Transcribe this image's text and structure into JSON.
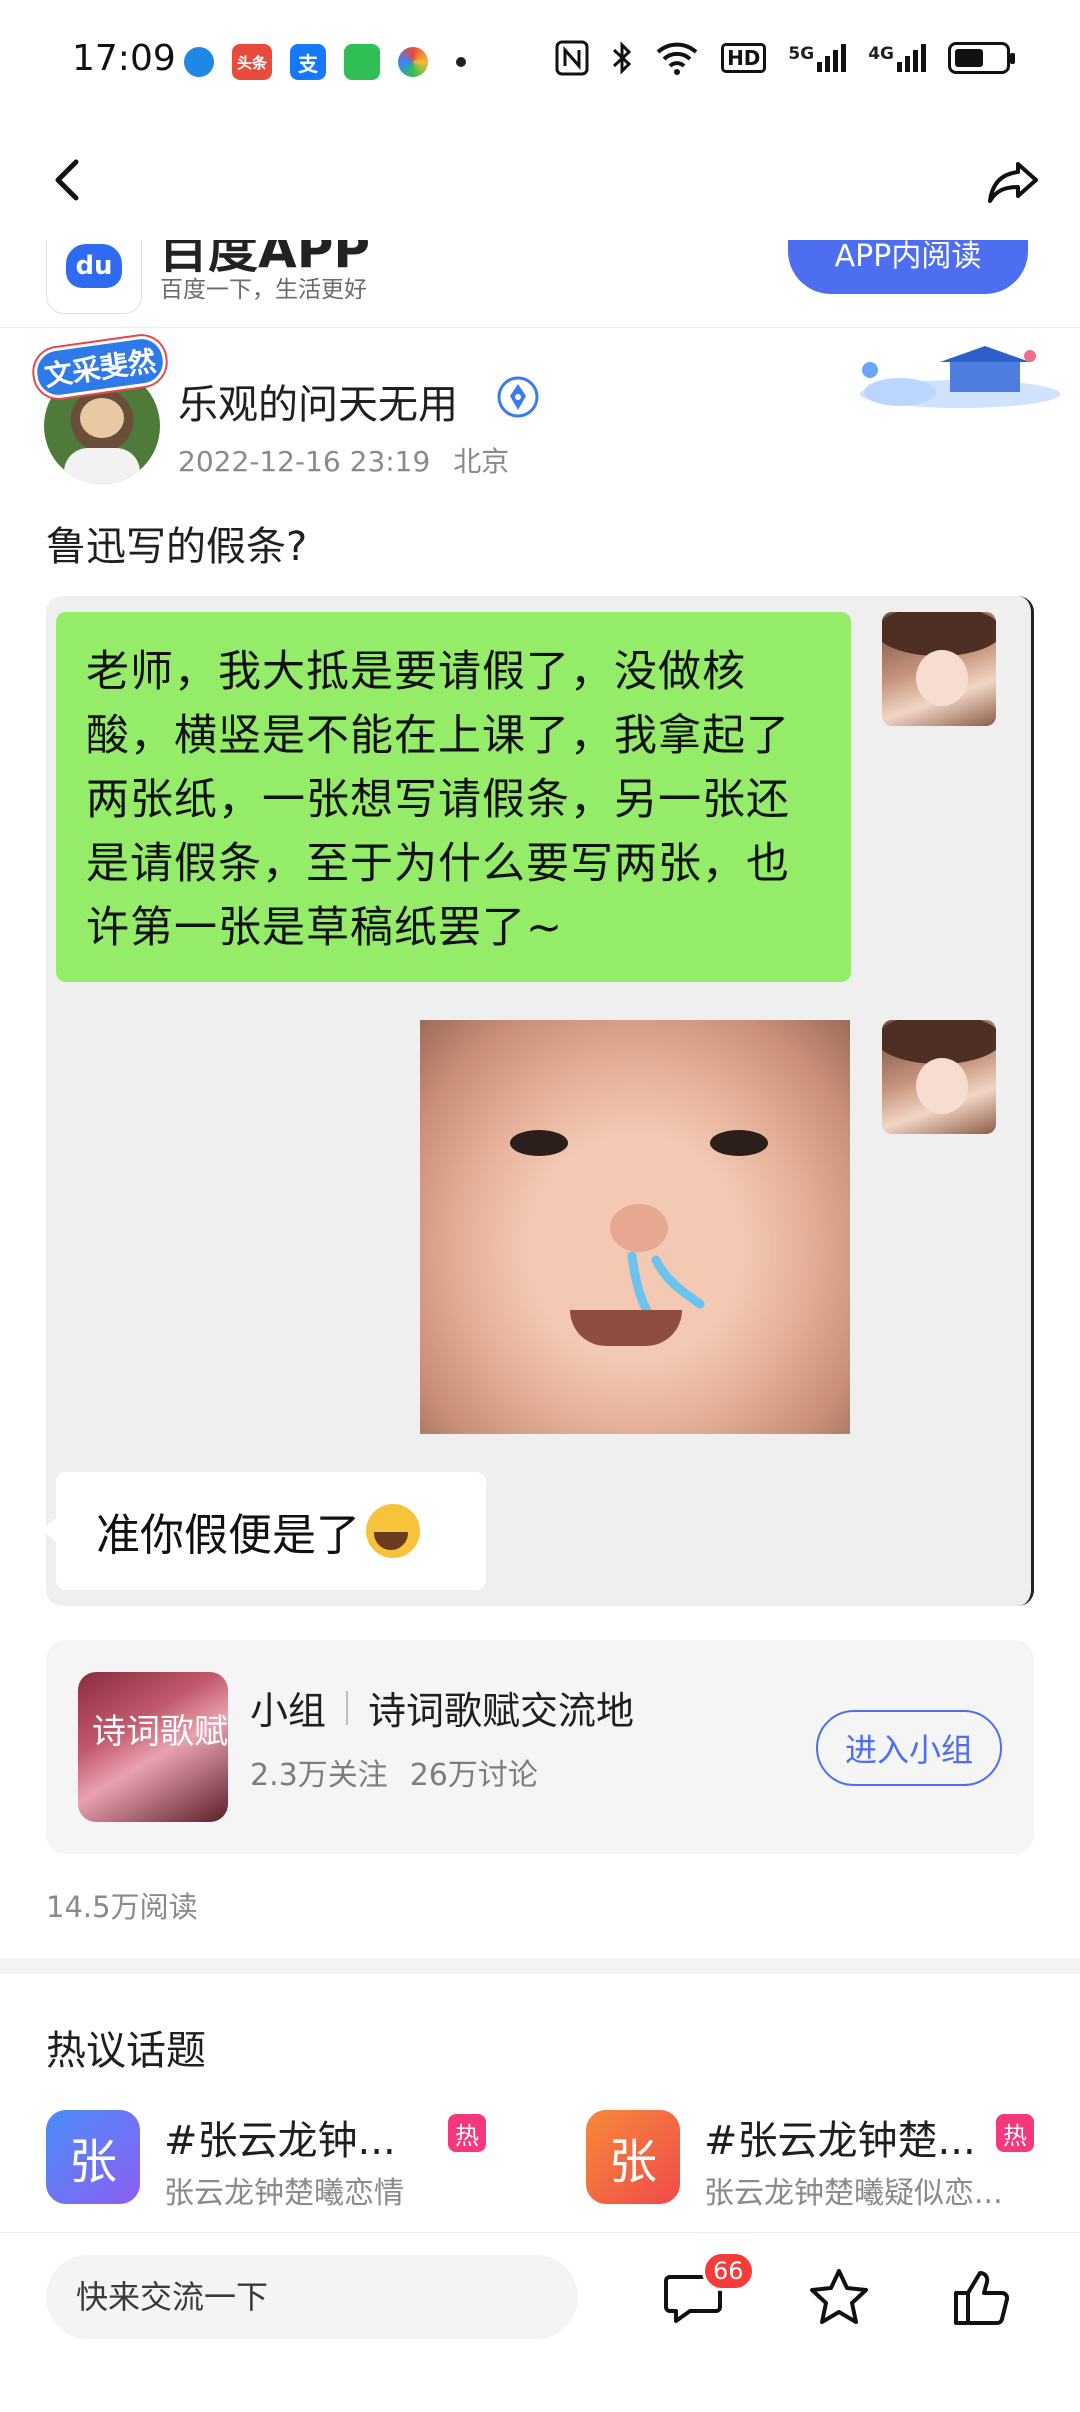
{
  "status_bar": {
    "time": "17:09",
    "apps": [
      {
        "icon": "bird-app-icon",
        "label": "",
        "color": "#1f87e5"
      },
      {
        "icon": "toutiao-app-icon",
        "label": "头条",
        "color": "#e64b3c"
      },
      {
        "icon": "alipay-app-icon",
        "label": "支",
        "color": "#1678ff"
      },
      {
        "icon": "chat-app-icon",
        "label": "",
        "color": "#2fbf55"
      },
      {
        "icon": "circle-app-icon",
        "label": "",
        "color": "#3a86ff"
      }
    ],
    "right_icons": [
      "nfc-icon",
      "bluetooth-icon",
      "wifi-icon",
      "hd-icon",
      "5g-signal-icon",
      "4g-signal-icon",
      "battery-icon"
    ],
    "hd_label": "HD",
    "net1": "5G",
    "net2": "4G"
  },
  "banner": {
    "title": "百度APP",
    "subtitle": "百度一下，生活更好",
    "logo_text": "du",
    "button_label": "APP内阅读"
  },
  "author": {
    "name": "乐观的问天无用",
    "badge": "文采斐然",
    "date": "2022-12-16 23:19",
    "location": "北京"
  },
  "post": {
    "title": "鲁迅写的假条?",
    "chat_message_1": "老师，我大抵是要请假了，没做核酸，横竖是不能在上课了，我拿起了两张纸，一张想写请假条，另一张还是请假条，至于为什么要写两张，也许第一张是草稿纸罢了~",
    "chat_message_2": "准你假便是了",
    "read_count": "14.5万阅读"
  },
  "group": {
    "type_label": "小组",
    "name": "诗词歌赋交流地",
    "thumb_text": "诗词歌赋",
    "followers": "2.3万关注",
    "discussions": "26万讨论",
    "join_label": "进入小组"
  },
  "hot_topics": {
    "title": "热议话题",
    "items": [
      {
        "icon_text": "张",
        "title": "#张云龙钟...",
        "hot": "热",
        "subtitle": "张云龙钟楚曦恋情",
        "color": "#6a6df2"
      },
      {
        "icon_text": "张",
        "title": "#张云龙钟楚...",
        "hot": "热",
        "subtitle": "张云龙钟楚曦疑似恋...",
        "color": "#f5673a"
      }
    ]
  },
  "bottom_bar": {
    "comment_placeholder": "快来交流一下",
    "comment_count": "66"
  },
  "colors": {
    "accent": "#4e6ef2",
    "chat_green": "#95ec69",
    "hot_badge": "#f5387e",
    "badge_red": "#f63b3b"
  }
}
